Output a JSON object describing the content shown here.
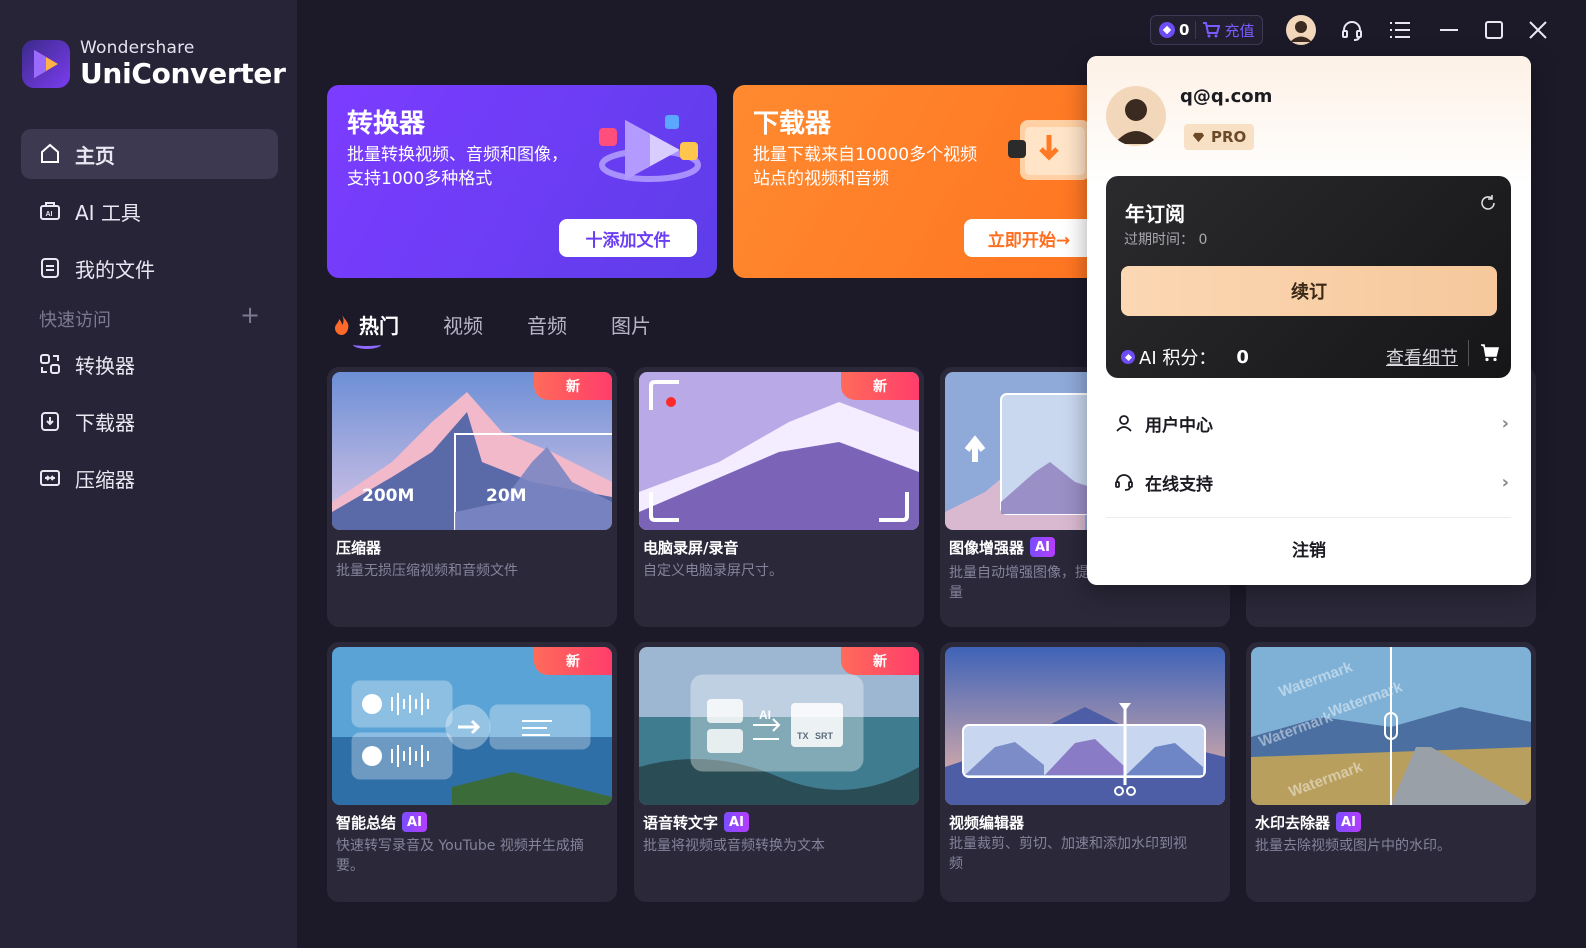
{
  "app": {
    "brand": "Wondershare",
    "name": "UniConverter"
  },
  "sidebar": {
    "items": [
      {
        "label": "主页",
        "icon": "home-icon"
      },
      {
        "label": "AI 工具",
        "icon": "ai-toolbox-icon"
      },
      {
        "label": "我的文件",
        "icon": "file-icon"
      }
    ],
    "quick_access_title": "快速访问",
    "quick_items": [
      {
        "label": "转换器",
        "icon": "converter-icon"
      },
      {
        "label": "下载器",
        "icon": "downloader-icon"
      },
      {
        "label": "压缩器",
        "icon": "compressor-icon"
      }
    ]
  },
  "topbar": {
    "credits": "0",
    "charge_label": "充值"
  },
  "banners": {
    "converter": {
      "title": "转换器",
      "desc": "批量转换视频、音频和图像，支持1000多种格式",
      "button": "十添加文件"
    },
    "downloader": {
      "title": "下载器",
      "desc": "批量下载来自10000多个视频站点的视频和音频",
      "button": "立即开始→"
    }
  },
  "tabs": [
    "热门",
    "视频",
    "音频",
    "图片"
  ],
  "badges": {
    "new": "新",
    "ai": "AI"
  },
  "cards": [
    {
      "title": "压缩器",
      "desc": "批量无损压缩视频和音频文件",
      "thumb_from": "200M",
      "thumb_to": "20M"
    },
    {
      "title": "电脑录屏/录音",
      "desc": "自定义电脑录屏尺寸。"
    },
    {
      "title": "图像增强器",
      "desc": "批量自动增强图像，提",
      "desc_tail": "量"
    },
    {
      "title": "智能总结",
      "desc": "快速转写录音及 YouTube 视频并生成摘要。"
    },
    {
      "title": "语音转文字",
      "desc": "批量将视频或音频转换为文本",
      "thumb_labels": {
        "ai": "AI",
        "tx": "TX",
        "srt": "SRT"
      }
    },
    {
      "title": "视频编辑器",
      "desc": "批量裁剪、剪切、加速和添加水印到视频"
    },
    {
      "title": "水印去除器",
      "desc": "批量去除视频或图片中的水印。",
      "watermark": "Watermark"
    }
  ],
  "popup": {
    "email": "q@q.com",
    "plan_badge": "PRO",
    "subscription_title": "年订阅",
    "expiry_label": "过期时间：",
    "expiry_value": "0",
    "renew_button": "续订",
    "ai_credits_label": "AI 积分：",
    "ai_credits_value": "0",
    "details_link": "查看细节",
    "menu": [
      {
        "label": "用户中心",
        "icon": "user-icon"
      },
      {
        "label": "在线支持",
        "icon": "headset-icon"
      }
    ],
    "logout": "注销"
  },
  "colors": {
    "accent": "#7b5bff",
    "sidebar_bg": "#262436",
    "main_bg": "#1c1a29",
    "converter_banner": "#7c3cff",
    "downloader_banner": "#ff7a25"
  }
}
